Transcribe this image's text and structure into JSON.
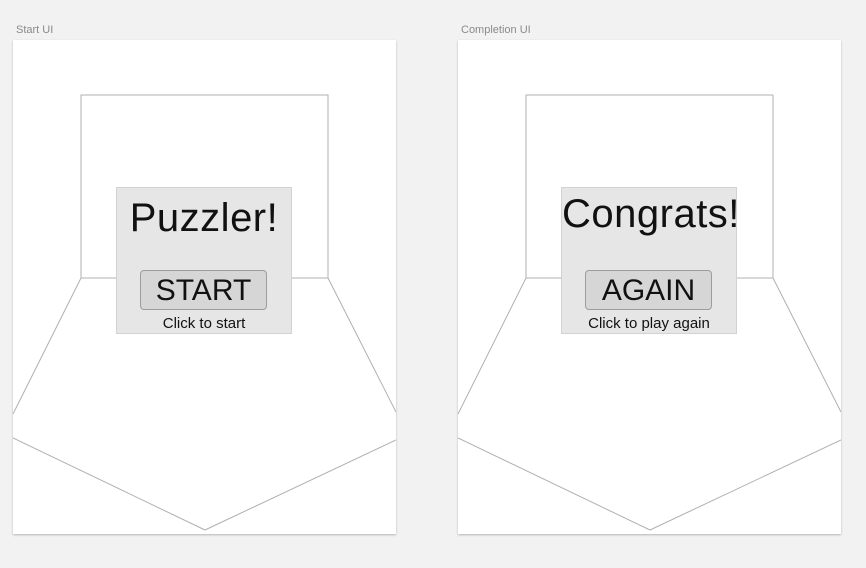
{
  "artboards": [
    {
      "label": "Start UI",
      "title": "Puzzler!",
      "button": "START",
      "caption": "Click to start"
    },
    {
      "label": "Completion UI",
      "title": "Congrats!",
      "button": "AGAIN",
      "caption": "Click to play again"
    }
  ],
  "colors": {
    "canvas": "#f2f2f2",
    "artboard": "#ffffff",
    "panel": "#e6e6e6",
    "button": "#d6d6d6",
    "wireframe_line": "#b0b0b0"
  }
}
